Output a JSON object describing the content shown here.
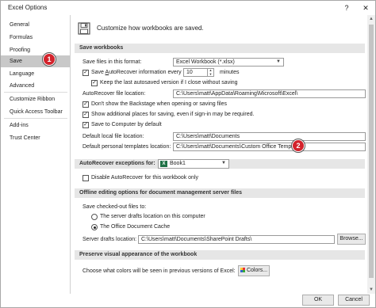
{
  "window": {
    "title": "Excel Options",
    "help_glyph": "?",
    "close_glyph": "✕"
  },
  "sidebar": {
    "items": [
      {
        "label": "General"
      },
      {
        "label": "Formulas"
      },
      {
        "label": "Proofing"
      },
      {
        "label": "Save",
        "selected": true
      },
      {
        "label": "Language"
      },
      {
        "label": "Advanced"
      },
      {
        "label": "Customize Ribbon"
      },
      {
        "label": "Quick Access Toolbar"
      },
      {
        "label": "Add-ins"
      },
      {
        "label": "Trust Center"
      }
    ],
    "badge": "1"
  },
  "header": {
    "text": "Customize how workbooks are saved.",
    "icon": "save-disk-icon"
  },
  "save_workbooks": {
    "title": "Save workbooks",
    "format_label": "Save files in this format:",
    "format_value": "Excel Workbook (*.xlsx)",
    "autorecover_label_pre": "Save ",
    "autorecover_label_u": "A",
    "autorecover_label_post": "utoRecover information every",
    "autorecover_minutes": "10",
    "minutes_label": "minutes",
    "keep_last_label": "Keep the last autosaved version if I close without saving",
    "autorecover_location_label": "AutoRecover file location:",
    "autorecover_location_value": "C:\\Users\\matt\\AppData\\Roaming\\Microsoft\\Excel\\",
    "backstage_label": "Don't show the Backstage when opening or saving files",
    "additional_places_label": "Show additional places for saving, even if sign-in may be required.",
    "save_computer_label": "Save to Computer by default",
    "default_local_label": "Default local file location:",
    "default_local_value": "C:\\Users\\matt\\Documents",
    "templates_label": "Default personal templates location:",
    "templates_value": "C:\\Users\\matt\\Documents\\Custom Office Templates\\",
    "badge": "2"
  },
  "exceptions": {
    "title": "AutoRecover exceptions for:",
    "workbook": "Book1",
    "disable_label": "Disable AutoRecover for this workbook only"
  },
  "offline": {
    "title": "Offline editing options for document management server files",
    "save_checked_out_label": "Save checked-out files to:",
    "server_drafts_label": "The server drafts location on this computer",
    "office_cache_label": "The Office Document Cache",
    "server_location_label": "Server drafts location:",
    "server_location_value": "C:\\Users\\matt\\Documents\\SharePoint Drafts\\",
    "browse_label": "Browse..."
  },
  "preserve": {
    "title": "Preserve visual appearance of the workbook",
    "colors_label": "Choose what colors will be seen in previous versions of Excel:",
    "colors_button": "Colors..."
  },
  "footer": {
    "ok_label": "OK",
    "cancel_label": "Cancel"
  },
  "colors": {
    "badge": "#d3232c",
    "selected_item": "#c8c8c8",
    "section_bg": "#e6e6e6",
    "excel_green": "#1e7145"
  }
}
